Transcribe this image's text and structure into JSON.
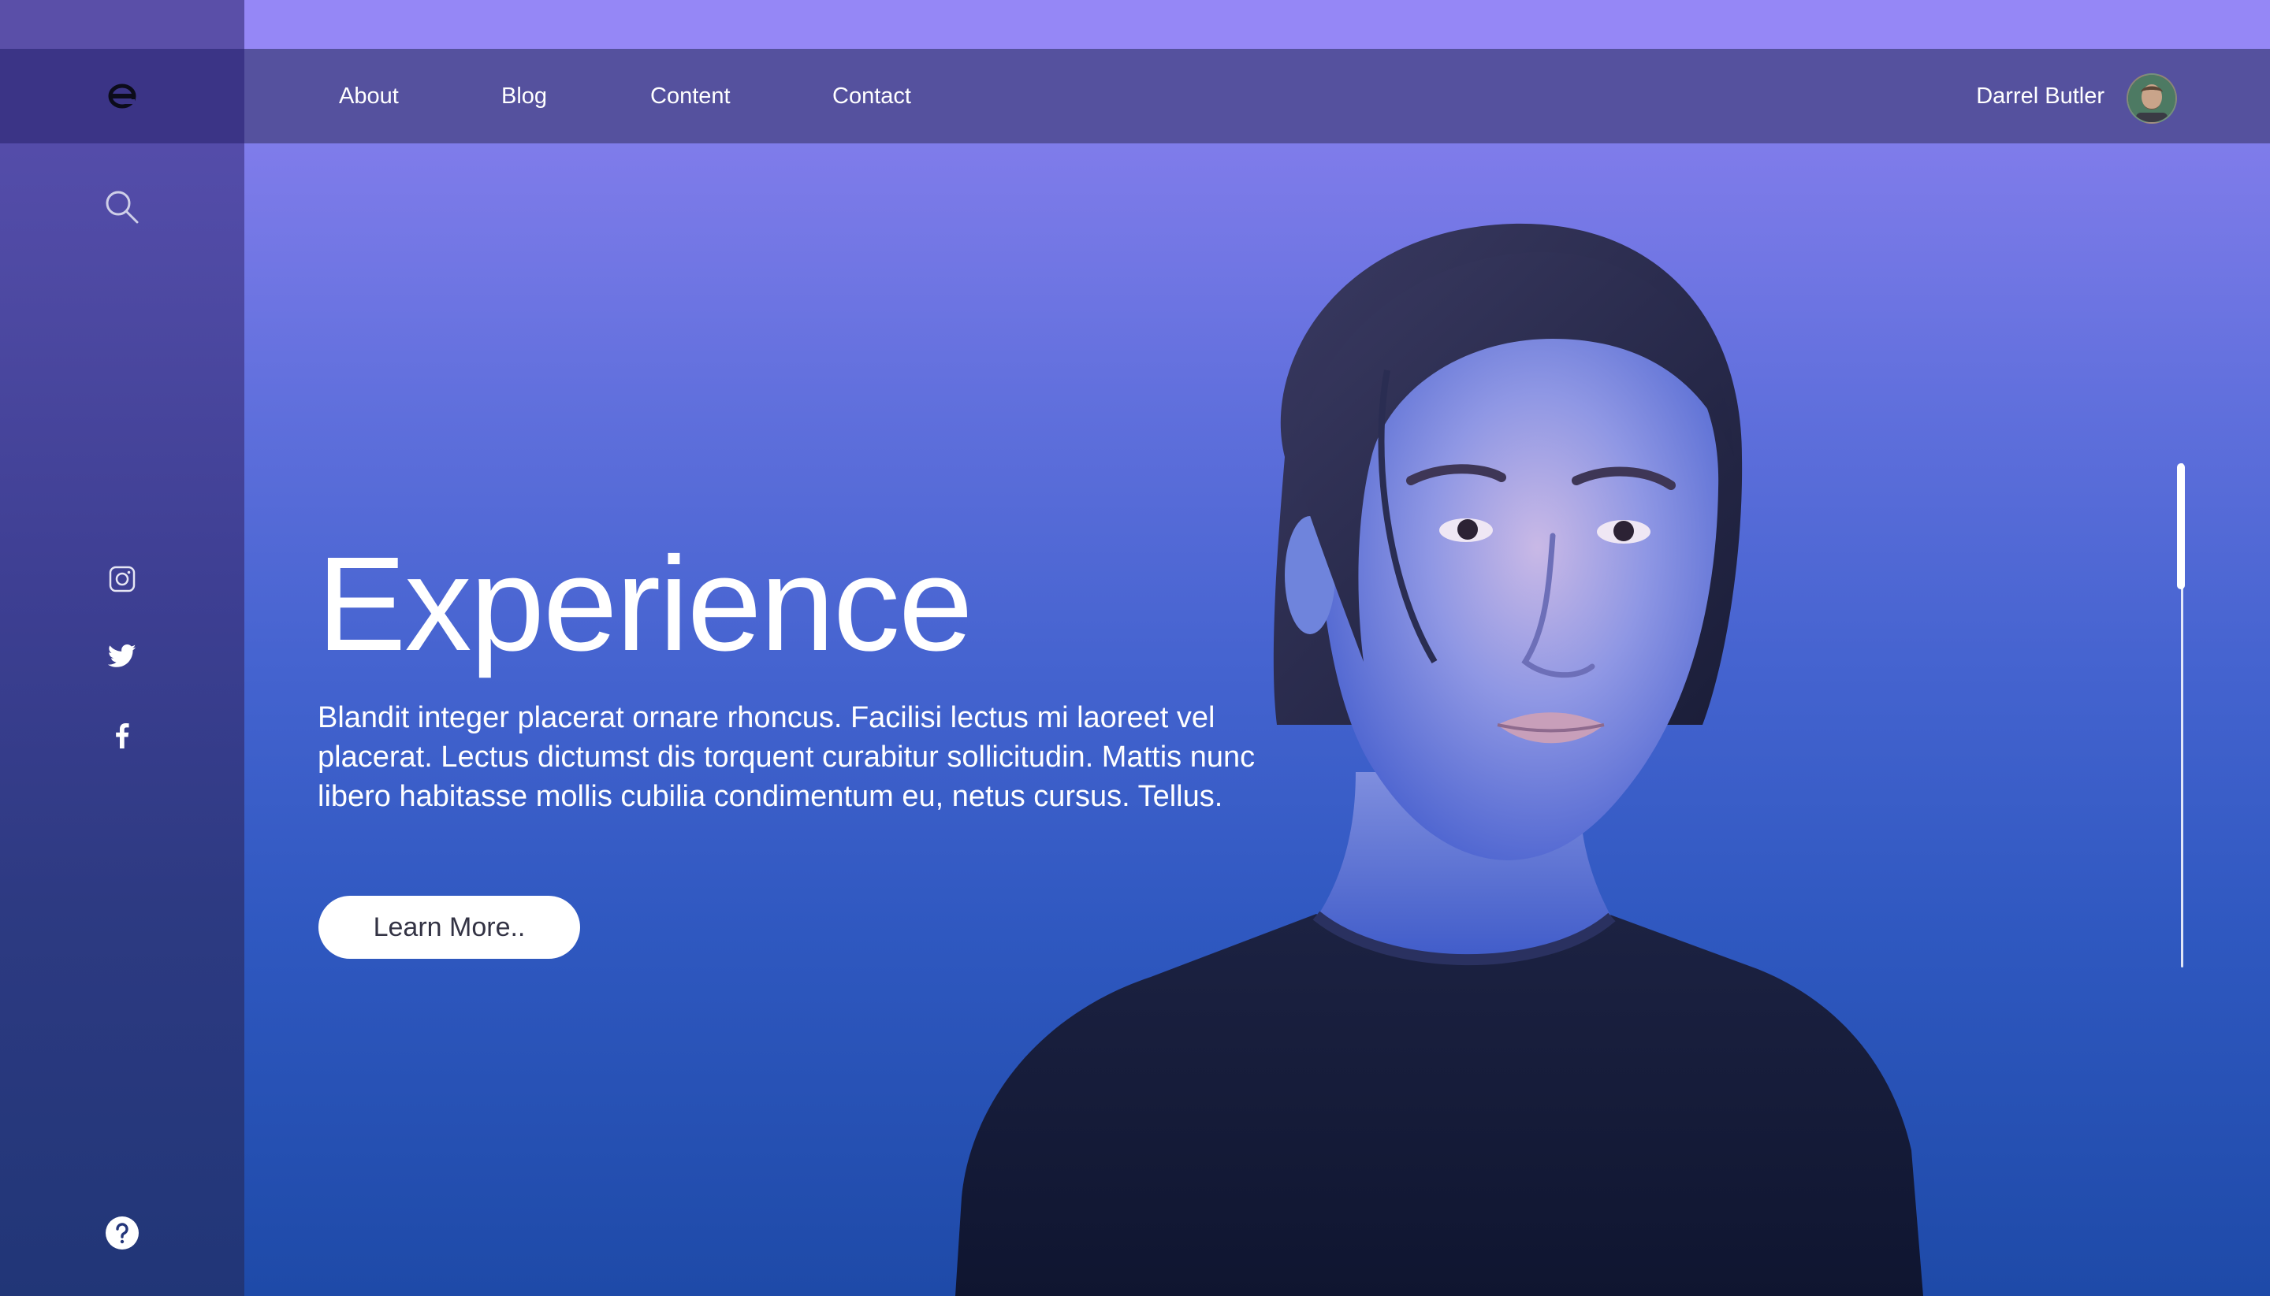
{
  "nav": {
    "items": [
      {
        "label": "About"
      },
      {
        "label": "Blog"
      },
      {
        "label": "Content"
      },
      {
        "label": "Contact"
      }
    ]
  },
  "user": {
    "name": "Darrel Butler"
  },
  "hero": {
    "title": "Experience",
    "description": "Blandit integer placerat ornare rhoncus. Facilisi lectus mi laoreet vel placerat. Lectus dictumst dis torquent curabitur sollicitudin. Mattis nunc libero habitasse mollis cubilia condimentum eu, netus cursus. Tellus.",
    "button_label": "Learn More.."
  },
  "sidebar": {
    "icons": [
      "search-icon",
      "instagram-icon",
      "twitter-icon",
      "facebook-icon",
      "help-icon"
    ]
  },
  "colors": {
    "accent": "#9587f6",
    "navbar": "#55519e",
    "sidebar": "#3e3f93",
    "logo_box": "#3b3486"
  }
}
